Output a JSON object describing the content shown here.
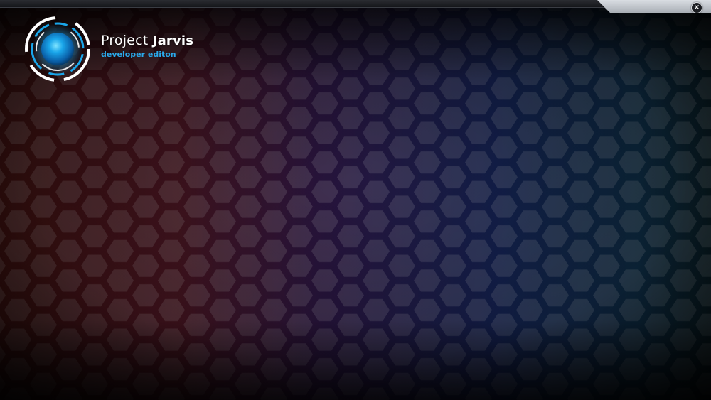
{
  "app": {
    "title_part1": "Project",
    "title_part2": "Jarvis",
    "subtitle": "developer editon"
  },
  "window": {
    "close_icon": "close-icon",
    "close_glyph": "×"
  },
  "colors": {
    "accent": "#2aa9ea",
    "background_left": "#8a1f1a",
    "background_mid": "#3a1a5a",
    "background_right": "#1a3a8a",
    "background_far_right": "#0f4a5a"
  },
  "icons": {
    "logo": "glowing-ring-logo-icon"
  }
}
